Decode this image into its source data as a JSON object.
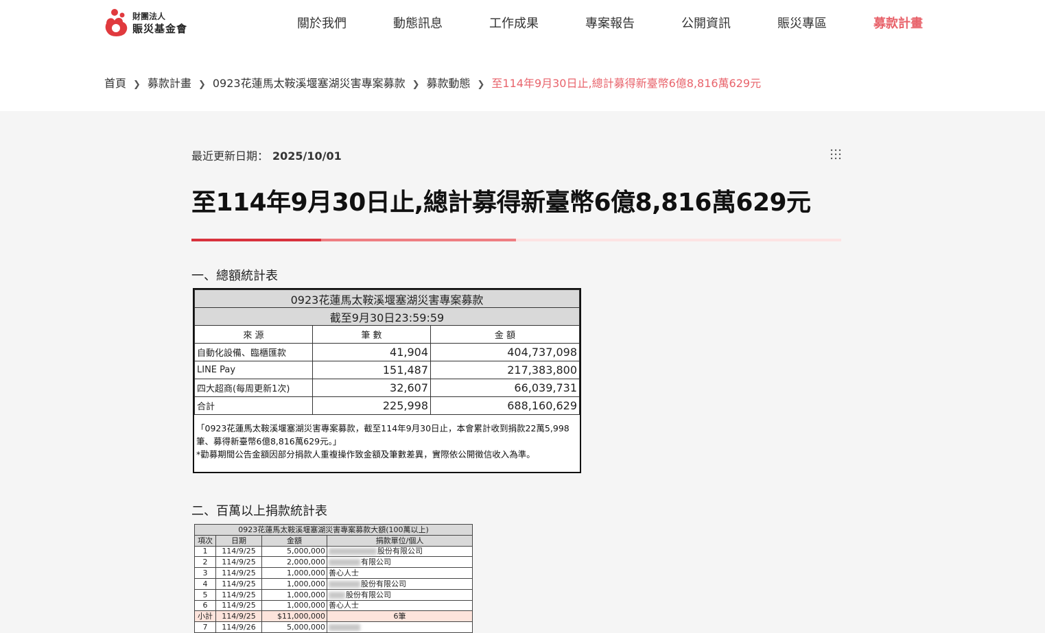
{
  "brand": {
    "line1": "財團法人",
    "line2": "賑災基金會",
    "color": "#e03a3e"
  },
  "nav": [
    {
      "label": "關於我們",
      "active": false
    },
    {
      "label": "動態訊息",
      "active": false
    },
    {
      "label": "工作成果",
      "active": false
    },
    {
      "label": "專案報告",
      "active": false
    },
    {
      "label": "公開資訊",
      "active": false
    },
    {
      "label": "賑災專區",
      "active": false
    },
    {
      "label": "募款計畫",
      "active": true
    }
  ],
  "breadcrumb": [
    "首頁",
    "募款計畫",
    "0923花蓮馬太鞍溪堰塞湖災害專案募款",
    "募款動態"
  ],
  "breadcrumb_current": "至114年9月30日止,總計募得新臺幣6億8,816萬629元",
  "meta": {
    "label": "最近更新日期：",
    "date": "2025/10/01"
  },
  "title": "至114年9月30日止,總計募得新臺幣6億8,816萬629元",
  "section1": "一、總額統計表",
  "section2": "二、百萬以上捐款統計表",
  "table1": {
    "title": "0923花蓮馬太鞍溪堰塞湖災害專案募款",
    "subtitle": "截至9月30日23:59:59",
    "headers": [
      "來 源",
      "筆 數",
      "金 額"
    ],
    "rows": [
      {
        "source": "自動化設備、臨櫃匯款",
        "count": "41,904",
        "amount": "404,737,098"
      },
      {
        "source": "LINE Pay",
        "count": "151,487",
        "amount": "217,383,800"
      },
      {
        "source": "四大超商(每周更新1次)",
        "count": "32,607",
        "amount": "66,039,731"
      },
      {
        "source": "合計",
        "count": "225,998",
        "amount": "688,160,629"
      }
    ],
    "note1": "「0923花蓮馬太鞍溪堰塞湖災害專案募款，截至114年9月30日止，本會累計收到捐款22萬5,998筆、募得新臺幣6億8,816萬629元。」",
    "note2": "*勸募期間公告金額因部分捐款人重複操作致金額及筆數差異，實際依公開徵信收入為準。"
  },
  "table2": {
    "title": "0923花蓮馬太鞍溪堰塞湖災害專案募款大額(100萬以上)",
    "headers": [
      "項次",
      "日期",
      "金額",
      "捐款單位/個人"
    ],
    "rows": [
      {
        "no": "1",
        "date": "114/9/25",
        "amount": "5,000,000",
        "donor": "股份有限公司"
      },
      {
        "no": "2",
        "date": "114/9/25",
        "amount": "2,000,000",
        "donor": "有限公司"
      },
      {
        "no": "3",
        "date": "114/9/25",
        "amount": "1,000,000",
        "donor": "善心人士"
      },
      {
        "no": "4",
        "date": "114/9/25",
        "amount": "1,000,000",
        "donor": "股份有限公司"
      },
      {
        "no": "5",
        "date": "114/9/25",
        "amount": "1,000,000",
        "donor": "股份有限公司"
      },
      {
        "no": "6",
        "date": "114/9/25",
        "amount": "1,000,000",
        "donor": "善心人士"
      }
    ],
    "subtotal": {
      "no": "小計",
      "date": "114/9/25",
      "amount": "$11,000,000",
      "donor": "6筆"
    },
    "last_row": {
      "no": "7",
      "date": "114/9/26",
      "amount": "5,000,000",
      "donor": ""
    }
  }
}
